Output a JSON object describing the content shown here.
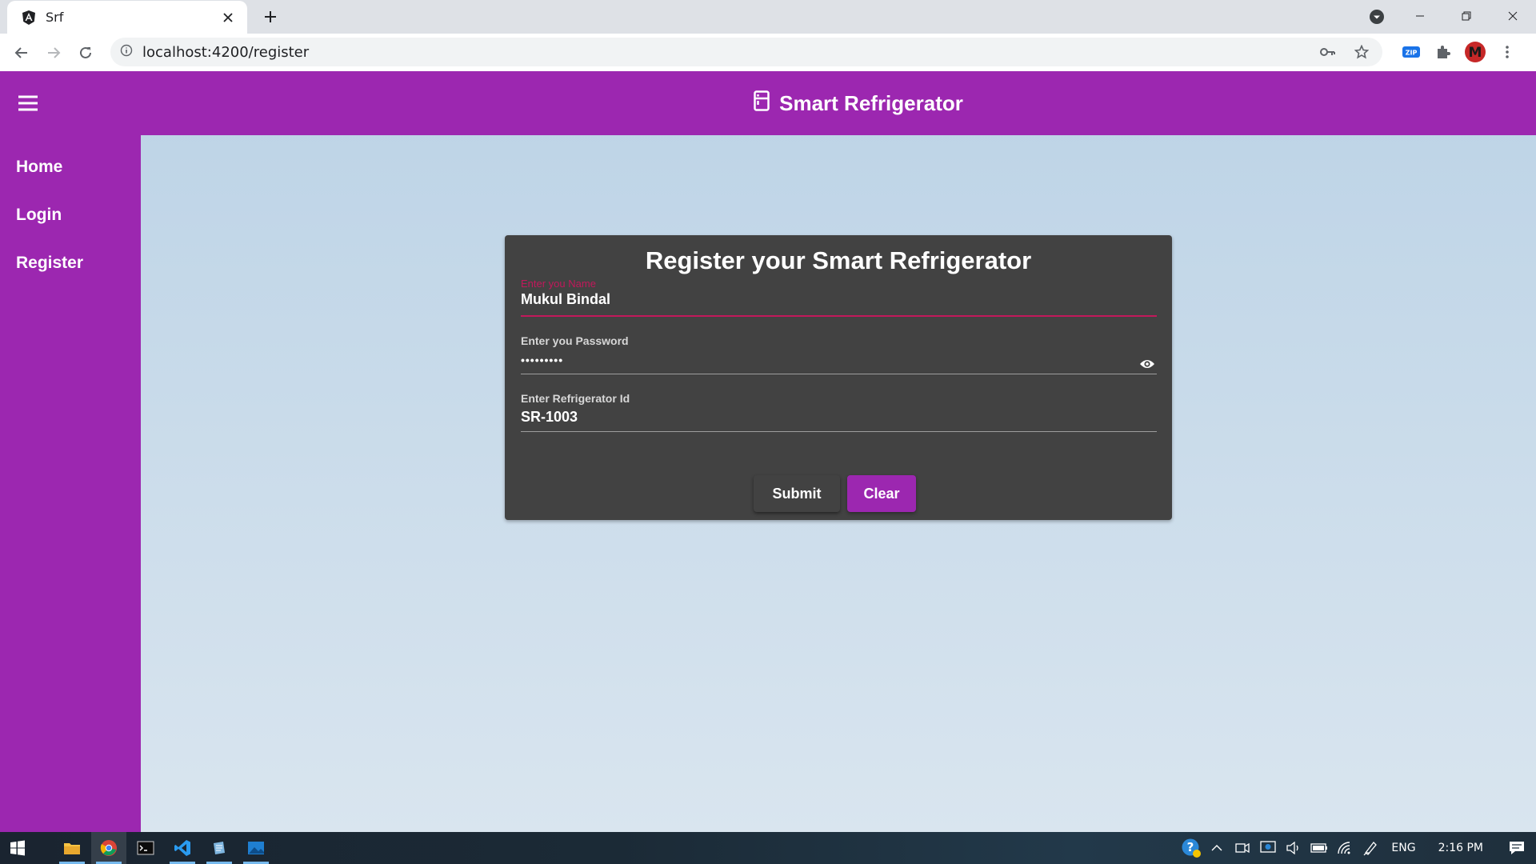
{
  "browser": {
    "tab_title": "Srf",
    "url": "localhost:4200/register",
    "profile_initial": "M",
    "zip_badge": "ZIP"
  },
  "app": {
    "title": "Smart Refrigerator",
    "nav_items": [
      "Home",
      "Login",
      "Register"
    ],
    "accent_color": "#9c27b0"
  },
  "form": {
    "heading": "Register your Smart Refrigerator",
    "name_label": "Enter you Name",
    "name_value": "Mukul Bindal",
    "password_label": "Enter you Password",
    "password_value": "•••••••••",
    "fridge_label": "Enter Refrigerator Id",
    "fridge_value": "SR-1003",
    "submit_label": "Submit",
    "clear_label": "Clear"
  },
  "taskbar": {
    "language": "ENG",
    "time": "2:16 PM"
  }
}
